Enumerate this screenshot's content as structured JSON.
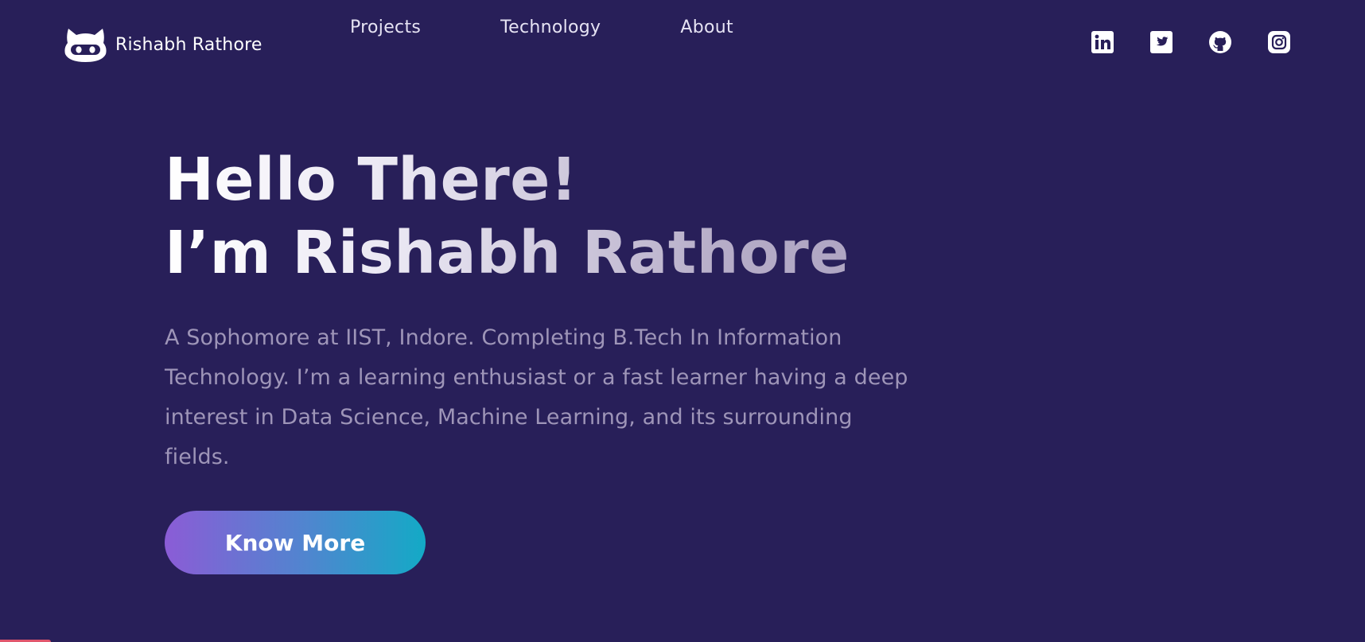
{
  "brand": {
    "name": "Rishabh Rathore",
    "logo_icon": "ninja-cat-logo-icon"
  },
  "nav": {
    "links": [
      "Projects",
      "Technology",
      "About"
    ]
  },
  "social": [
    {
      "name": "LinkedIn",
      "icon": "linkedin-icon"
    },
    {
      "name": "Twitter",
      "icon": "twitter-icon"
    },
    {
      "name": "GitHub",
      "icon": "github-icon"
    },
    {
      "name": "Instagram",
      "icon": "instagram-icon"
    }
  ],
  "hero": {
    "title_line1": "Hello There!",
    "title_line2": "I’m Rishabh Rathore",
    "description_lines": [
      "A Sophomore at IIST, Indore. Completing B.Tech In Information",
      "Technology. I’m a learning enthusiast or a fast learner having a deep",
      "interest in Data Science, Machine Learning, and its surrounding",
      "fields."
    ],
    "cta_label": "Know More"
  },
  "colors": {
    "background": "#281f59",
    "text_primary": "#ffffff",
    "text_muted": "#9e95b8",
    "cta_gradient_start": "#8b5cd6",
    "cta_gradient_end": "#13aac6"
  }
}
